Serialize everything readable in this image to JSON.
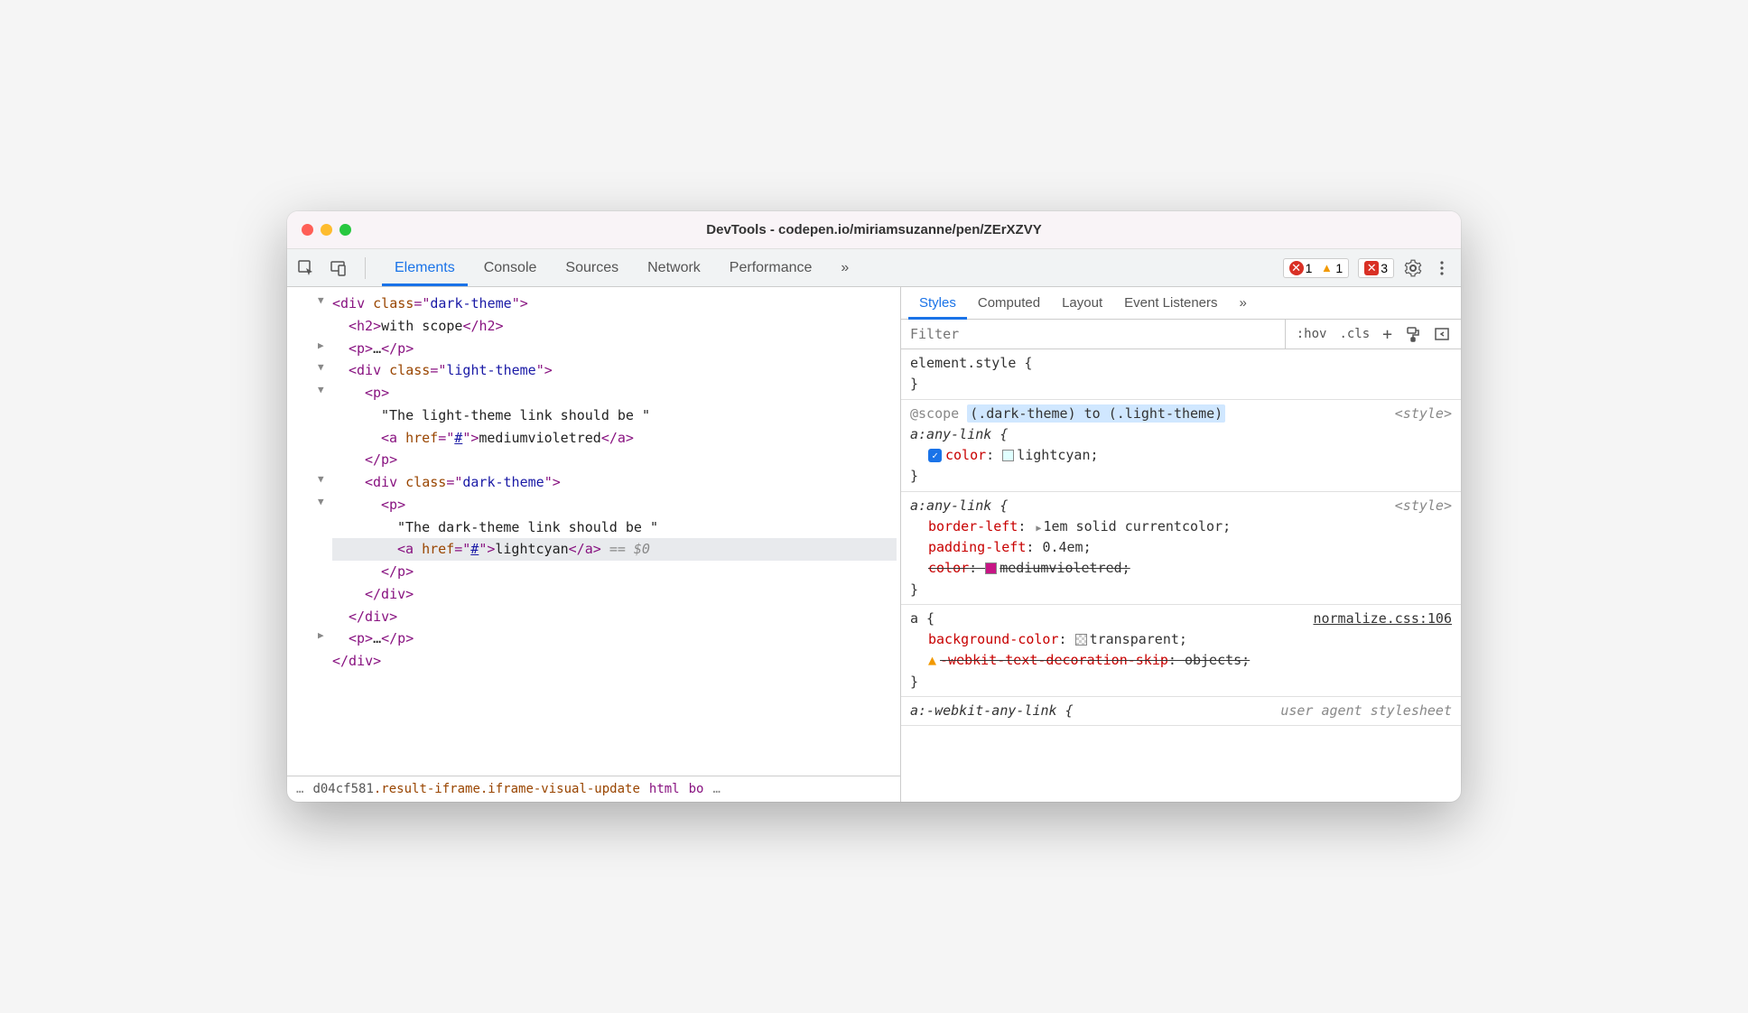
{
  "window": {
    "title": "DevTools - codepen.io/miriamsuzanne/pen/ZErXZVY"
  },
  "toolbar": {
    "tabs": [
      "Elements",
      "Console",
      "Sources",
      "Network",
      "Performance"
    ],
    "more": "»",
    "errors": "1",
    "warnings": "1",
    "issues": "3"
  },
  "dom": {
    "lines": [
      {
        "indent": 0,
        "arrow": "▼",
        "type": "open",
        "tag": "div",
        "attrs": [
          {
            "name": "class",
            "val": "dark-theme"
          }
        ]
      },
      {
        "indent": 1,
        "type": "inline",
        "tag": "h2",
        "text": "with scope"
      },
      {
        "indent": 1,
        "arrow": "▶",
        "type": "collapsed",
        "tag": "p"
      },
      {
        "indent": 1,
        "arrow": "▼",
        "type": "open",
        "tag": "div",
        "attrs": [
          {
            "name": "class",
            "val": "light-theme"
          }
        ]
      },
      {
        "indent": 2,
        "arrow": "▼",
        "type": "open",
        "tag": "p"
      },
      {
        "indent": 3,
        "type": "text",
        "text": "\"The light-theme link should be \""
      },
      {
        "indent": 3,
        "type": "inline",
        "tag": "a",
        "attrs": [
          {
            "name": "href",
            "val": "#",
            "link": true
          }
        ],
        "text": "mediumvioletred"
      },
      {
        "indent": 2,
        "type": "close",
        "tag": "p"
      },
      {
        "indent": 2,
        "arrow": "▼",
        "type": "open",
        "tag": "div",
        "attrs": [
          {
            "name": "class",
            "val": "dark-theme"
          }
        ]
      },
      {
        "indent": 3,
        "arrow": "▼",
        "type": "open",
        "tag": "p"
      },
      {
        "indent": 4,
        "type": "text",
        "text": "\"The dark-theme link should be \""
      },
      {
        "indent": 4,
        "hl": true,
        "type": "inline",
        "tag": "a",
        "attrs": [
          {
            "name": "href",
            "val": "#",
            "link": true
          }
        ],
        "text": "lightcyan",
        "selected": "== $0"
      },
      {
        "indent": 3,
        "type": "close",
        "tag": "p"
      },
      {
        "indent": 2,
        "type": "close",
        "tag": "div"
      },
      {
        "indent": 1,
        "type": "close",
        "tag": "div"
      },
      {
        "indent": 1,
        "arrow": "▶",
        "type": "collapsed",
        "tag": "p"
      },
      {
        "indent": 0,
        "type": "close",
        "tag": "div"
      }
    ]
  },
  "breadcrumb": {
    "prefix": "…",
    "seg1": "d04cf581",
    "seg2": ".result-iframe.iframe-visual-update",
    "seg3": "html",
    "seg4": "bo",
    "suffix": "…"
  },
  "styles": {
    "tabs": [
      "Styles",
      "Computed",
      "Layout",
      "Event Listeners"
    ],
    "more": "»",
    "filter_placeholder": "Filter",
    "buttons": [
      ":hov",
      ".cls",
      "+"
    ],
    "rules": [
      {
        "selector": "element.style {",
        "close": "}"
      },
      {
        "scope_prefix": "@scope ",
        "scope_hl": "(.dark-theme) to (.light-theme)",
        "selector": "a:any-link {",
        "src": "<style>",
        "props": [
          {
            "checked": true,
            "name": "color",
            "swatch": "#e0ffff",
            "val": "lightcyan;"
          }
        ],
        "close": "}"
      },
      {
        "selector": "a:any-link {",
        "src": "<style>",
        "props": [
          {
            "name": "border-left",
            "tri": true,
            "val": "1em solid currentcolor;"
          },
          {
            "name": "padding-left",
            "val": "0.4em;"
          },
          {
            "name": "color",
            "strike": true,
            "swatch": "#c71585",
            "val": "mediumvioletred;"
          }
        ],
        "close": "}"
      },
      {
        "selector": "a {",
        "src": "normalize.css:106",
        "src_link": true,
        "props": [
          {
            "name": "background-color",
            "swatch": "transparent",
            "val": "transparent;"
          },
          {
            "warn": true,
            "name": "-webkit-text-decoration-skip",
            "strike": true,
            "val": "objects;"
          }
        ],
        "close": "}"
      },
      {
        "selector": "a:-webkit-any-link {",
        "src": "user agent stylesheet",
        "src_italic": true
      }
    ]
  }
}
